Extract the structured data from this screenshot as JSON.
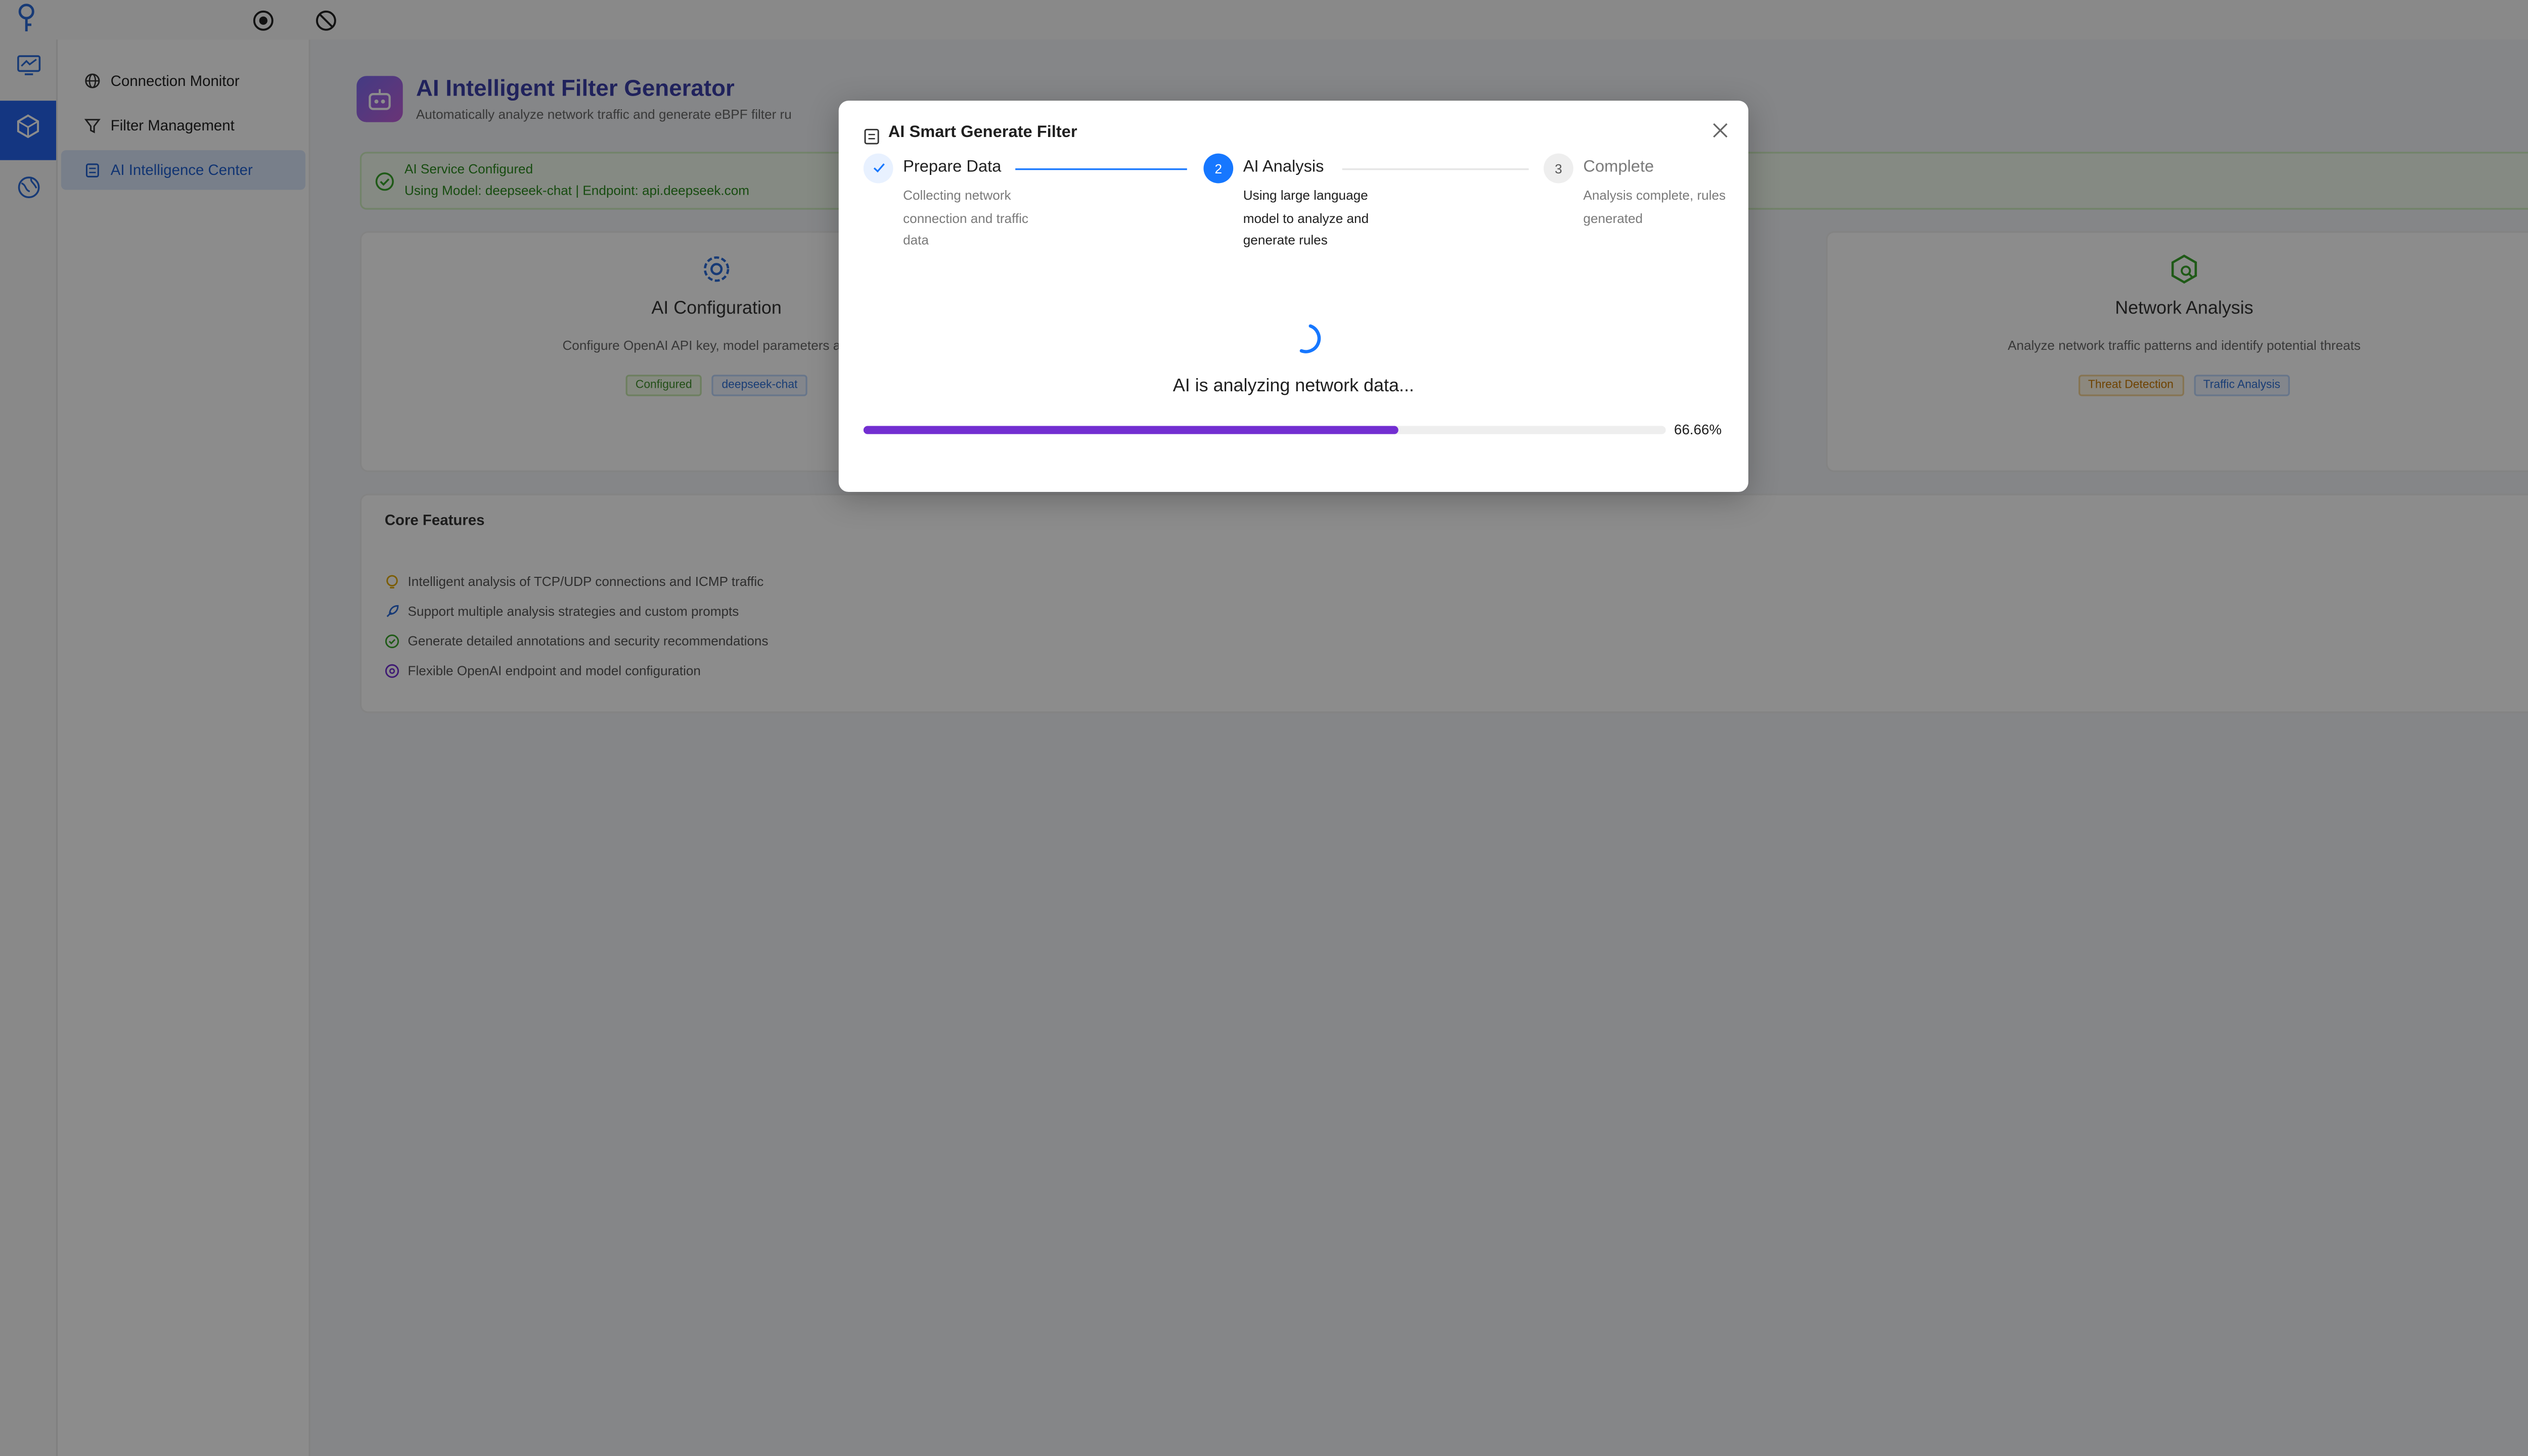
{
  "topbar": {
    "logo_icon": "key-icon",
    "record_icon": "record-icon",
    "block_icon": "block-icon",
    "translate_icon": "translate-icon"
  },
  "rail": {
    "items": [
      {
        "icon": "monitor-icon",
        "active": false
      },
      {
        "icon": "cube-icon",
        "active": true
      },
      {
        "icon": "globe-icon",
        "active": false
      }
    ],
    "active_color": "#2563eb"
  },
  "sidebar": {
    "items": [
      {
        "label": "Connection Monitor",
        "icon": "globe-icon",
        "active": false
      },
      {
        "label": "Filter Management",
        "icon": "filter-icon",
        "active": false
      },
      {
        "label": "AI Intelligence Center",
        "icon": "robot-icon",
        "active": true
      }
    ]
  },
  "main": {
    "title": "AI Intelligent Filter Generator",
    "subtitle": "Automatically analyze network traffic and generate eBPF filter ru",
    "alert": {
      "title": "AI Service Configured",
      "text": "Using Model: deepseek-chat | Endpoint: api.deepseek.com"
    },
    "cards": [
      {
        "icon": "gear-icon",
        "title": "AI Configuration",
        "description": "Configure OpenAI API key, model parameters and re",
        "tags": [
          {
            "label": "Configured",
            "color": "green"
          },
          {
            "label": "deepseek-chat",
            "color": "blue"
          }
        ]
      },
      {
        "icon": "security-scan-icon",
        "title": "Network Analysis",
        "description": "Analyze network traffic patterns and identify potential threats",
        "tags": [
          {
            "label": "Threat Detection",
            "color": "orange"
          },
          {
            "label": "Traffic Analysis",
            "color": "blue"
          }
        ]
      }
    ],
    "features": {
      "title": "Core Features",
      "items": [
        {
          "icon": "bulb-icon",
          "text": "Intelligent analysis of TCP/UDP connections and ICMP traffic"
        },
        {
          "icon": "rocket-icon",
          "text": "Support multiple analysis strategies and custom prompts"
        },
        {
          "icon": "check-circle-icon",
          "text": "Generate detailed annotations and security recommendations"
        },
        {
          "icon": "settings-icon",
          "text": "Flexible OpenAI endpoint and model configuration"
        }
      ]
    }
  },
  "modal": {
    "title": "AI Smart Generate Filter",
    "title_icon": "robot-icon",
    "close_icon": "close-icon",
    "steps": [
      {
        "number": "1",
        "title": "Prepare Data",
        "description": "Collecting network connection and traffic data",
        "status": "finished"
      },
      {
        "number": "2",
        "title": "AI Analysis",
        "description": "Using large language model to analyze and generate rules",
        "status": "process"
      },
      {
        "number": "3",
        "title": "Complete",
        "description": "Analysis complete, rules generated",
        "status": "wait"
      }
    ],
    "status_text": "AI is analyzing network data...",
    "progress": {
      "value": 66.66,
      "label": "66.66%",
      "color": "#722ed1"
    }
  }
}
